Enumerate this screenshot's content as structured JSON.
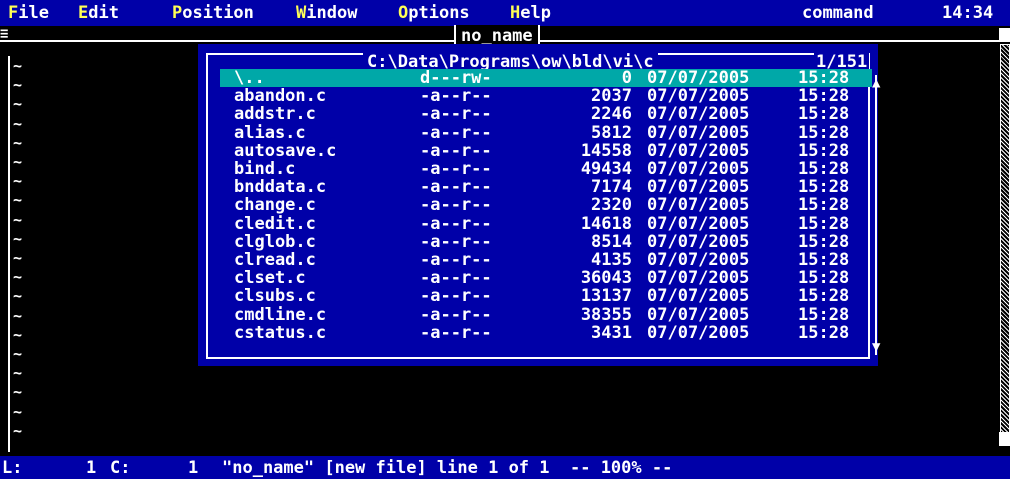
{
  "menu": {
    "items": [
      {
        "hotkey": "F",
        "rest": "ile"
      },
      {
        "hotkey": "E",
        "rest": "dit"
      },
      {
        "hotkey": "P",
        "rest": "osition"
      },
      {
        "hotkey": "W",
        "rest": "indow"
      },
      {
        "hotkey": "O",
        "rest": "ptions"
      },
      {
        "hotkey": "H",
        "rest": "elp"
      }
    ],
    "mode": "command",
    "clock": "14:34"
  },
  "window": {
    "title": "no_name"
  },
  "dialog": {
    "path": "C:\\Data\\Programs\\ow\\bld\\vi\\c",
    "count": "1/151",
    "files": [
      {
        "name": "\\..",
        "attr": "d---rw-",
        "size": "0",
        "date": "07/07/2005",
        "time": "15:28"
      },
      {
        "name": "abandon.c",
        "attr": "-a--r--",
        "size": "2037",
        "date": "07/07/2005",
        "time": "15:28"
      },
      {
        "name": "addstr.c",
        "attr": "-a--r--",
        "size": "2246",
        "date": "07/07/2005",
        "time": "15:28"
      },
      {
        "name": "alias.c",
        "attr": "-a--r--",
        "size": "5812",
        "date": "07/07/2005",
        "time": "15:28"
      },
      {
        "name": "autosave.c",
        "attr": "-a--r--",
        "size": "14558",
        "date": "07/07/2005",
        "time": "15:28"
      },
      {
        "name": "bind.c",
        "attr": "-a--r--",
        "size": "49434",
        "date": "07/07/2005",
        "time": "15:28"
      },
      {
        "name": "bnddata.c",
        "attr": "-a--r--",
        "size": "7174",
        "date": "07/07/2005",
        "time": "15:28"
      },
      {
        "name": "change.c",
        "attr": "-a--r--",
        "size": "2320",
        "date": "07/07/2005",
        "time": "15:28"
      },
      {
        "name": "cledit.c",
        "attr": "-a--r--",
        "size": "14618",
        "date": "07/07/2005",
        "time": "15:28"
      },
      {
        "name": "clglob.c",
        "attr": "-a--r--",
        "size": "8514",
        "date": "07/07/2005",
        "time": "15:28"
      },
      {
        "name": "clread.c",
        "attr": "-a--r--",
        "size": "4135",
        "date": "07/07/2005",
        "time": "15:28"
      },
      {
        "name": "clset.c",
        "attr": "-a--r--",
        "size": "36043",
        "date": "07/07/2005",
        "time": "15:28"
      },
      {
        "name": "clsubs.c",
        "attr": "-a--r--",
        "size": "13137",
        "date": "07/07/2005",
        "time": "15:28"
      },
      {
        "name": "cmdline.c",
        "attr": "-a--r--",
        "size": "38355",
        "date": "07/07/2005",
        "time": "15:28"
      },
      {
        "name": "cstatus.c",
        "attr": "-a--r--",
        "size": "3431",
        "date": "07/07/2005",
        "time": "15:28"
      }
    ]
  },
  "editor": {
    "tilde": "~",
    "tilde_rows": 20
  },
  "status": {
    "line_label": "L:",
    "line_value": "1",
    "col_label": "C:",
    "col_value": "1",
    "message": "\"no_name\" [new file] line 1 of 1  -- 100% --"
  },
  "colors": {
    "menu_bg": "#0000a8",
    "hotkey": "#ffff55",
    "selection": "#00a8a8",
    "background": "#000000"
  }
}
